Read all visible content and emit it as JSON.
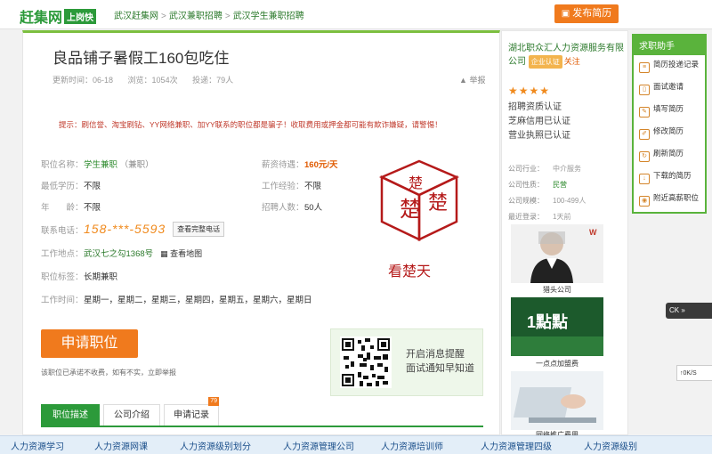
{
  "header": {
    "logo_main": "赶集网",
    "logo_sub": "上岗快",
    "breadcrumbs": [
      "武汉赶集网",
      "武汉兼职招聘",
      "武汉学生兼职招聘"
    ],
    "breadcrumb_separator": ">",
    "publish_label": "发布简历"
  },
  "job": {
    "title": "良品铺子暑假工160包吃住",
    "updated": "更新时间：06-18",
    "views": "浏览：1054次",
    "applicants": "投递：79人",
    "report_label": "举报",
    "warning": "提示：刷信誉、淘宝刷钻、YY网络兼职、加YY联系的职位都是骗子！收取费用或押金都可能有欺诈嫌疑，请警惕！",
    "fields": {
      "position_label": "职位名称：",
      "position_value": "学生兼职",
      "position_type": "（兼职）",
      "salary_label": "薪资待遇：",
      "salary_value": "160元/天",
      "education_label": "最低学历：",
      "education_value": "不限",
      "experience_label": "工作经验：",
      "experience_value": "不限",
      "age_label": "年　　龄：",
      "age_value": "不限",
      "headcount_label": "招聘人数：",
      "headcount_value": "50人",
      "phone_label": "联系电话：",
      "phone_value": "158-***-5593",
      "phone_button": "查看完整电话",
      "address_label": "工作地点：",
      "address_value": "武汉七之勾1368号",
      "map_link": "查看地图",
      "tags_label": "职位标签：",
      "tags_value": "长期兼职",
      "worktime_label": "工作时间：",
      "worktime_value": "星期一，星期二，星期三，星期四，星期五，星期六，星期日"
    },
    "stamp_char_1": "楚",
    "stamp_char_2": "楚",
    "stamp_char_3": "楚",
    "stamp_caption": "看楚天",
    "apply_label": "申请职位",
    "apply_note": "该职位已承诺不收费，如有不实，立即举报",
    "qr_text_1": "开启消息提醒",
    "qr_text_2": "面试通知早知道",
    "tabs": [
      {
        "label": "职位描述"
      },
      {
        "label": "公司介绍"
      },
      {
        "label": "申请记录",
        "badge": "79"
      }
    ]
  },
  "company": {
    "name": "湖北职众汇人力资源服务有限公司",
    "auth_badge": "企业认证",
    "follow": "关注",
    "stars": "★★★★",
    "certs": [
      "招聘资质认证",
      "芝麻信用已认证",
      "营业执照已认证"
    ],
    "info": [
      {
        "k": "公司行业：",
        "v": "中介服务"
      },
      {
        "k": "公司性质：",
        "v": "民营"
      },
      {
        "k": "公司规模：",
        "v": "100-499人"
      },
      {
        "k": "最近登录：",
        "v": "1天前"
      }
    ],
    "ads": [
      "猎头公司",
      "一点点加盟费",
      "网络推广费用"
    ],
    "ad2_text": "1點點"
  },
  "help": {
    "title": "求职助手",
    "items": [
      "简历投递记录",
      "面试邀请",
      "填写简历",
      "修改简历",
      "刷新简历",
      "下载的简历",
      "附近高薪职位"
    ]
  },
  "side": {
    "widget1": "CK",
    "widget2": "0K/S"
  },
  "footer_links": [
    "人力资源学习",
    "人力资源网课",
    "人力资源级别划分",
    "人力资源管理公司",
    "人力资源培训师",
    "人力资源管理四级",
    "人力资源级别"
  ]
}
